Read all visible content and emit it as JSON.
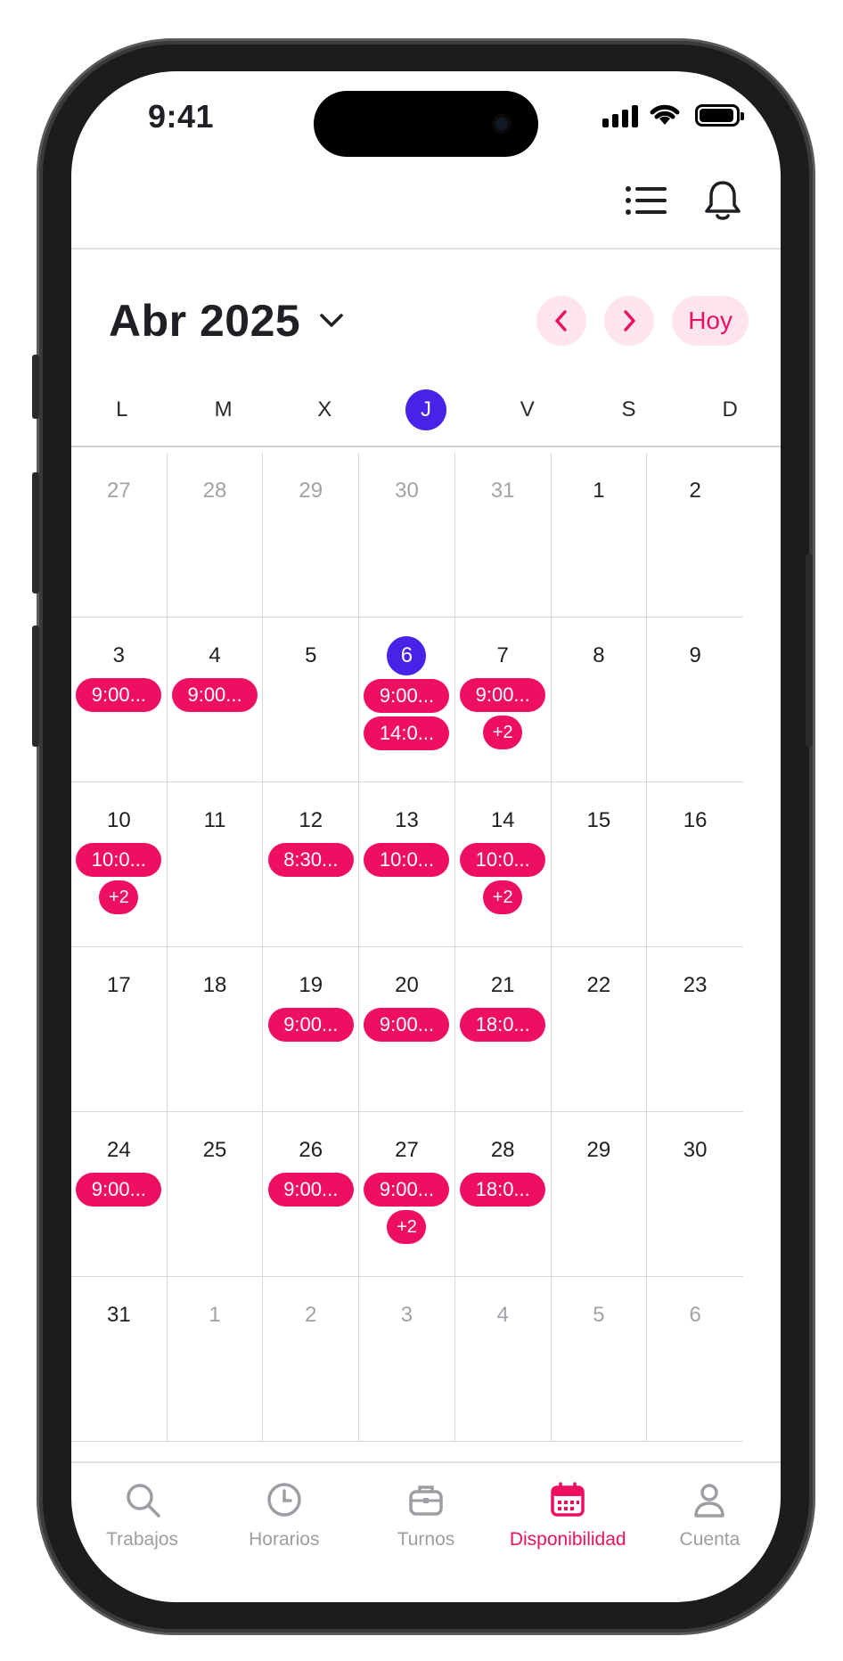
{
  "status_bar": {
    "time": "9:41"
  },
  "header": {
    "month_label": "Abr 2025",
    "today_label": "Hoy"
  },
  "weekdays": [
    {
      "label": "L",
      "today": false
    },
    {
      "label": "M",
      "today": false
    },
    {
      "label": "X",
      "today": false
    },
    {
      "label": "J",
      "today": true
    },
    {
      "label": "V",
      "today": false
    },
    {
      "label": "S",
      "today": false
    },
    {
      "label": "D",
      "today": false
    }
  ],
  "weeks": [
    [
      {
        "day": "27",
        "muted": true,
        "events": []
      },
      {
        "day": "28",
        "muted": true,
        "events": []
      },
      {
        "day": "29",
        "muted": true,
        "events": []
      },
      {
        "day": "30",
        "muted": true,
        "events": []
      },
      {
        "day": "31",
        "muted": true,
        "events": []
      },
      {
        "day": "1",
        "muted": false,
        "events": []
      },
      {
        "day": "2",
        "muted": false,
        "events": []
      }
    ],
    [
      {
        "day": "3",
        "muted": false,
        "events": [
          "9:00..."
        ]
      },
      {
        "day": "4",
        "muted": false,
        "events": [
          "9:00..."
        ]
      },
      {
        "day": "5",
        "muted": false,
        "events": []
      },
      {
        "day": "6",
        "muted": false,
        "today": true,
        "events": [
          "9:00...",
          "14:0..."
        ]
      },
      {
        "day": "7",
        "muted": false,
        "events": [
          "9:00..."
        ],
        "more": "+2"
      },
      {
        "day": "8",
        "muted": false,
        "events": []
      },
      {
        "day": "9",
        "muted": false,
        "events": []
      }
    ],
    [
      {
        "day": "10",
        "muted": false,
        "events": [
          "10:0..."
        ],
        "more": "+2"
      },
      {
        "day": "11",
        "muted": false,
        "events": []
      },
      {
        "day": "12",
        "muted": false,
        "events": [
          "8:30..."
        ]
      },
      {
        "day": "13",
        "muted": false,
        "events": [
          "10:0..."
        ]
      },
      {
        "day": "14",
        "muted": false,
        "events": [
          "10:0..."
        ],
        "more": "+2"
      },
      {
        "day": "15",
        "muted": false,
        "events": []
      },
      {
        "day": "16",
        "muted": false,
        "events": []
      }
    ],
    [
      {
        "day": "17",
        "muted": false,
        "events": []
      },
      {
        "day": "18",
        "muted": false,
        "events": []
      },
      {
        "day": "19",
        "muted": false,
        "events": [
          "9:00..."
        ]
      },
      {
        "day": "20",
        "muted": false,
        "events": [
          "9:00..."
        ]
      },
      {
        "day": "21",
        "muted": false,
        "events": [
          "18:0..."
        ]
      },
      {
        "day": "22",
        "muted": false,
        "events": []
      },
      {
        "day": "23",
        "muted": false,
        "events": []
      }
    ],
    [
      {
        "day": "24",
        "muted": false,
        "events": [
          "9:00..."
        ]
      },
      {
        "day": "25",
        "muted": false,
        "events": []
      },
      {
        "day": "26",
        "muted": false,
        "events": [
          "9:00..."
        ]
      },
      {
        "day": "27",
        "muted": false,
        "events": [
          "9:00..."
        ],
        "more": "+2"
      },
      {
        "day": "28",
        "muted": false,
        "events": [
          "18:0..."
        ]
      },
      {
        "day": "29",
        "muted": false,
        "events": []
      },
      {
        "day": "30",
        "muted": false,
        "events": []
      }
    ],
    [
      {
        "day": "31",
        "muted": false,
        "events": []
      },
      {
        "day": "1",
        "muted": true,
        "events": []
      },
      {
        "day": "2",
        "muted": true,
        "events": []
      },
      {
        "day": "3",
        "muted": true,
        "events": []
      },
      {
        "day": "4",
        "muted": true,
        "events": []
      },
      {
        "day": "5",
        "muted": true,
        "events": []
      },
      {
        "day": "6",
        "muted": true,
        "events": []
      }
    ]
  ],
  "tabs": [
    {
      "label": "Trabajos",
      "icon": "search-icon",
      "active": false
    },
    {
      "label": "Horarios",
      "icon": "clock-icon",
      "active": false
    },
    {
      "label": "Turnos",
      "icon": "briefcase-icon",
      "active": false
    },
    {
      "label": "Disponibilidad",
      "icon": "calendar-icon",
      "active": true
    },
    {
      "label": "Cuenta",
      "icon": "user-icon",
      "active": false
    }
  ],
  "colors": {
    "accent": "#ee0f63",
    "today": "#4723e8",
    "accent_soft": "#fde4ee",
    "muted_text": "#a2a2a8",
    "tab_inactive": "#9d9da4"
  }
}
